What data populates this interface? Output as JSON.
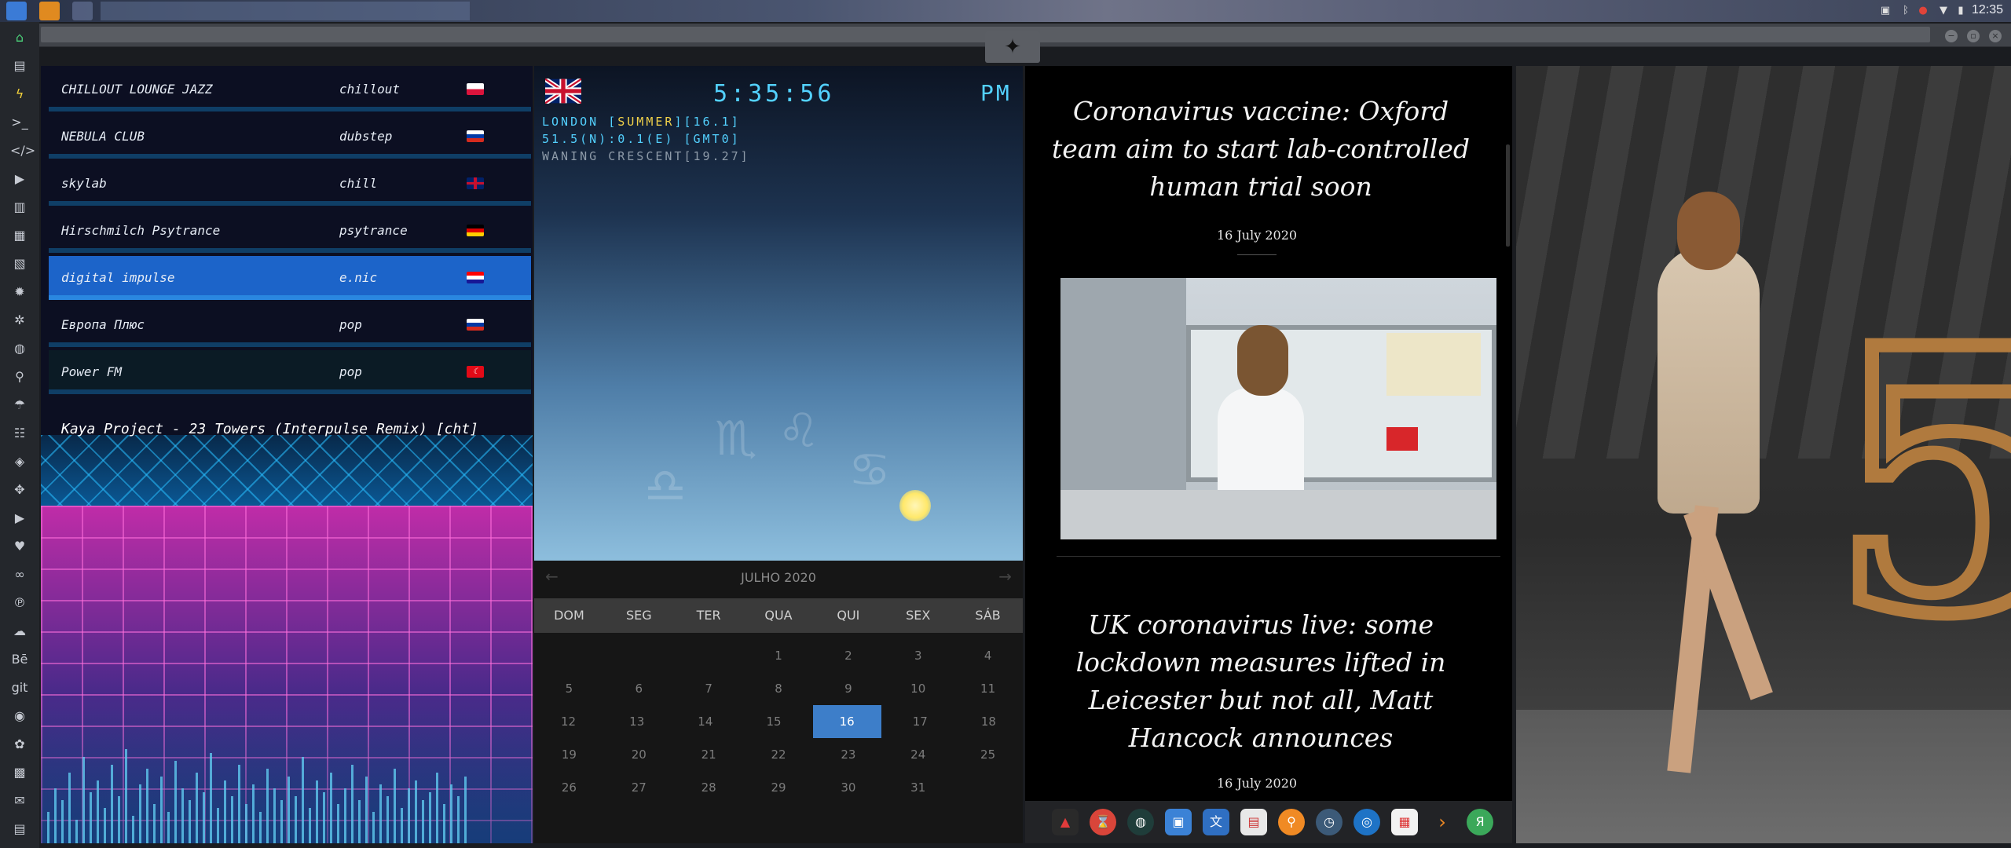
{
  "system": {
    "time": "12:35"
  },
  "radio": {
    "stations": [
      {
        "name": "CHILLOUT LOUNGE JAZZ",
        "genre": "chillout",
        "flag": "poland"
      },
      {
        "name": "NEBULA CLUB",
        "genre": "dubstep",
        "flag": "russia"
      },
      {
        "name": "skylab",
        "genre": "chill",
        "flag": "uk"
      },
      {
        "name": "Hirschmilch Psytrance",
        "genre": "psytrance",
        "flag": "germany"
      },
      {
        "name": "digital impulse",
        "genre": "e.nic",
        "flag": "croatia"
      },
      {
        "name": "Европа Плюс",
        "genre": "pop",
        "flag": "russia"
      },
      {
        "name": "Power FM",
        "genre": "pop",
        "flag": "turkey"
      }
    ],
    "now_playing": "Kaya Project - 23 Towers (Interpulse Remix) [cht]"
  },
  "weather": {
    "time": "5:35:56",
    "ampm": "PM",
    "line1_prefix": "LONDON [",
    "line1_season": "SUMMER",
    "line1_suffix": "][16.1]",
    "line2": "51.5(N):0.1(E) [GMT0]",
    "line3": "WANING CRESCENT[19.27]"
  },
  "calendar": {
    "title": "JULHO 2020",
    "weekdays": [
      "DOM",
      "SEG",
      "TER",
      "QUA",
      "QUI",
      "SEX",
      "SÁB"
    ],
    "rows": [
      [
        "",
        "",
        "",
        "1",
        "2",
        "3",
        "4"
      ],
      [
        "5",
        "6",
        "7",
        "8",
        "9",
        "10",
        "11"
      ],
      [
        "12",
        "13",
        "14",
        "15",
        "16",
        "17",
        "18"
      ],
      [
        "19",
        "20",
        "21",
        "22",
        "23",
        "24",
        "25"
      ],
      [
        "26",
        "27",
        "28",
        "29",
        "30",
        "31",
        ""
      ]
    ],
    "today": "16"
  },
  "news": {
    "articles": [
      {
        "headline": "Coronavirus vaccine: Oxford team aim to start lab-controlled human trial soon",
        "date": "16 July 2020"
      },
      {
        "headline": "UK coronavirus live: some lockdown measures lifted in Leicester but not all, Matt Hancock announces",
        "date": "16 July 2020"
      }
    ]
  },
  "colors": {
    "accent_cyan": "#53d1ff",
    "selected_station": "#1c64c9",
    "today": "#3d7ec9"
  }
}
